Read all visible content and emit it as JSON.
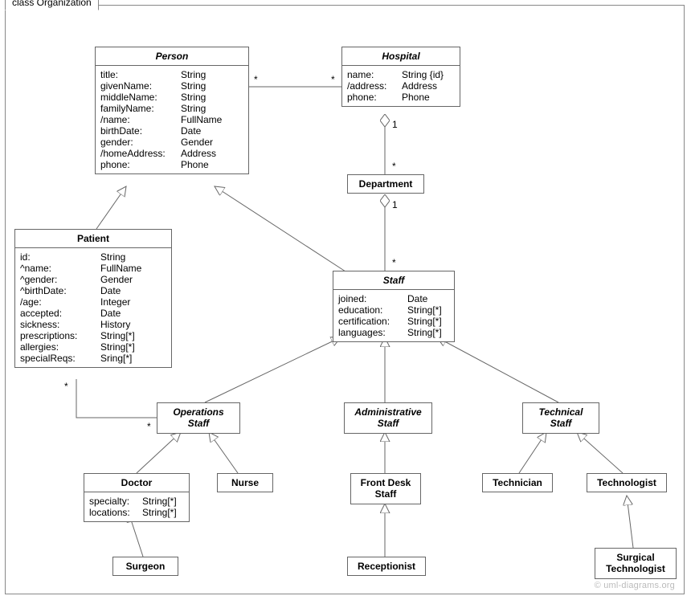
{
  "frame": {
    "title": "class Organization"
  },
  "watermark": "© uml-diagrams.org",
  "classes": {
    "person": {
      "title": "Person",
      "attrs": [
        [
          "title:",
          "String"
        ],
        [
          "givenName:",
          "String"
        ],
        [
          "middleName:",
          "String"
        ],
        [
          "familyName:",
          "String"
        ],
        [
          "/name:",
          "FullName"
        ],
        [
          "birthDate:",
          "Date"
        ],
        [
          "gender:",
          "Gender"
        ],
        [
          "/homeAddress:",
          "Address"
        ],
        [
          "phone:",
          "Phone"
        ]
      ]
    },
    "hospital": {
      "title": "Hospital",
      "attrs": [
        [
          "name:",
          "String {id}"
        ],
        [
          "/address:",
          "Address"
        ],
        [
          "phone:",
          "Phone"
        ]
      ]
    },
    "department": {
      "title": "Department"
    },
    "patient": {
      "title": "Patient",
      "attrs": [
        [
          "id:",
          "String"
        ],
        [
          "^name:",
          "FullName"
        ],
        [
          "^gender:",
          "Gender"
        ],
        [
          "^birthDate:",
          "Date"
        ],
        [
          "/age:",
          "Integer"
        ],
        [
          "accepted:",
          "Date"
        ],
        [
          "sickness:",
          "History"
        ],
        [
          "prescriptions:",
          "String[*]"
        ],
        [
          "allergies:",
          "String[*]"
        ],
        [
          "specialReqs:",
          "Sring[*]"
        ]
      ]
    },
    "staff": {
      "title": "Staff",
      "attrs": [
        [
          "joined:",
          "Date"
        ],
        [
          "education:",
          "String[*]"
        ],
        [
          "certification:",
          "String[*]"
        ],
        [
          "languages:",
          "String[*]"
        ]
      ]
    },
    "opsstaff": {
      "title": "Operations\nStaff"
    },
    "admstaff": {
      "title": "Administrative\nStaff"
    },
    "techstaff": {
      "title": "Technical\nStaff"
    },
    "doctor": {
      "title": "Doctor",
      "attrs": [
        [
          "specialty:",
          "String[*]"
        ],
        [
          "locations:",
          "String[*]"
        ]
      ]
    },
    "nurse": {
      "title": "Nurse"
    },
    "frontdesk": {
      "title": "Front Desk\nStaff"
    },
    "technician": {
      "title": "Technician"
    },
    "technologist": {
      "title": "Technologist"
    },
    "surgeon": {
      "title": "Surgeon"
    },
    "receptionist": {
      "title": "Receptionist"
    },
    "surgtech": {
      "title": "Surgical\nTechnologist"
    }
  },
  "mults": {
    "person_star": "*",
    "hosp_star": "*",
    "hosp_one": "1",
    "dept_star_top": "*",
    "dept_one": "1",
    "dept_star_side": "*",
    "patient_star": "*",
    "ops_star": "*"
  }
}
